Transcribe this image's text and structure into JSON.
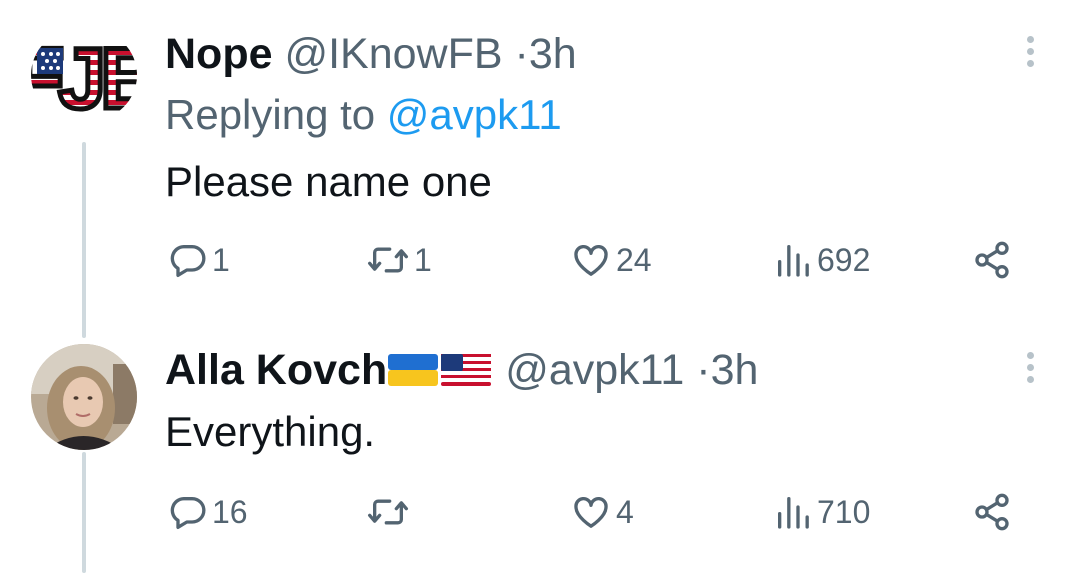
{
  "tweets": [
    {
      "name": "Nope",
      "handle": "@IKnowFB",
      "separator": "·",
      "time": "3h",
      "replying_label": "Replying to",
      "replying_to": "@avpk11",
      "text": "Please name one",
      "avatar_text": "FJB",
      "stats": {
        "replies": "1",
        "retweets": "1",
        "likes": "24",
        "views": "692"
      }
    },
    {
      "name": "Alla Kovch",
      "handle": "@avpk11",
      "separator": "·",
      "time": "3h",
      "text": "Everything.",
      "stats": {
        "replies": "16",
        "retweets": "",
        "likes": "4",
        "views": "710"
      }
    }
  ],
  "colors": {
    "text": "#0f1419",
    "secondary": "#536471",
    "link": "#1d9bf0",
    "thread": "#cfd9de"
  },
  "icons": [
    "reply-icon",
    "retweet-icon",
    "like-icon",
    "views-icon",
    "share-icon",
    "more-icon"
  ]
}
